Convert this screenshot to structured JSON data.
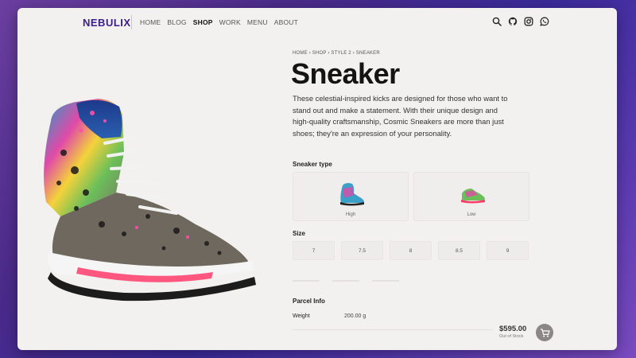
{
  "brand": {
    "logo": "NEBULIX"
  },
  "nav": {
    "items": [
      "HOME",
      "BLOG",
      "SHOP",
      "WORK",
      "MENU",
      "ABOUT"
    ],
    "active": "SHOP"
  },
  "header_icons": [
    "search-icon",
    "github-icon",
    "instagram-icon",
    "whatsapp-icon"
  ],
  "breadcrumb": [
    "HOME",
    "SHOP",
    "STYLE 2",
    "SNEAKER"
  ],
  "breadcrumb_separator": "›",
  "product": {
    "title": "Sneaker",
    "description": "These celestial-inspired kicks are designed for those who want to stand out and make a statement. With their unique design and high-quality craftsmanship, Cosmic Sneakers are more than just shoes; they're an expression of your personality.",
    "sneaker_type_label": "Sneaker type",
    "types": [
      {
        "label": "High"
      },
      {
        "label": "Low"
      }
    ],
    "size_label": "Size",
    "sizes": [
      "7",
      "7.5",
      "8",
      "8.5",
      "9"
    ],
    "parcel_label": "Parcel Info",
    "weight_label": "Weight",
    "weight_value": "200.00 g",
    "price": "$595.00",
    "stock_status": "Out of Stock"
  },
  "colors": {
    "accent": "#3b1e8c",
    "background": "#f3f1ef",
    "cart": "#8a8785"
  }
}
